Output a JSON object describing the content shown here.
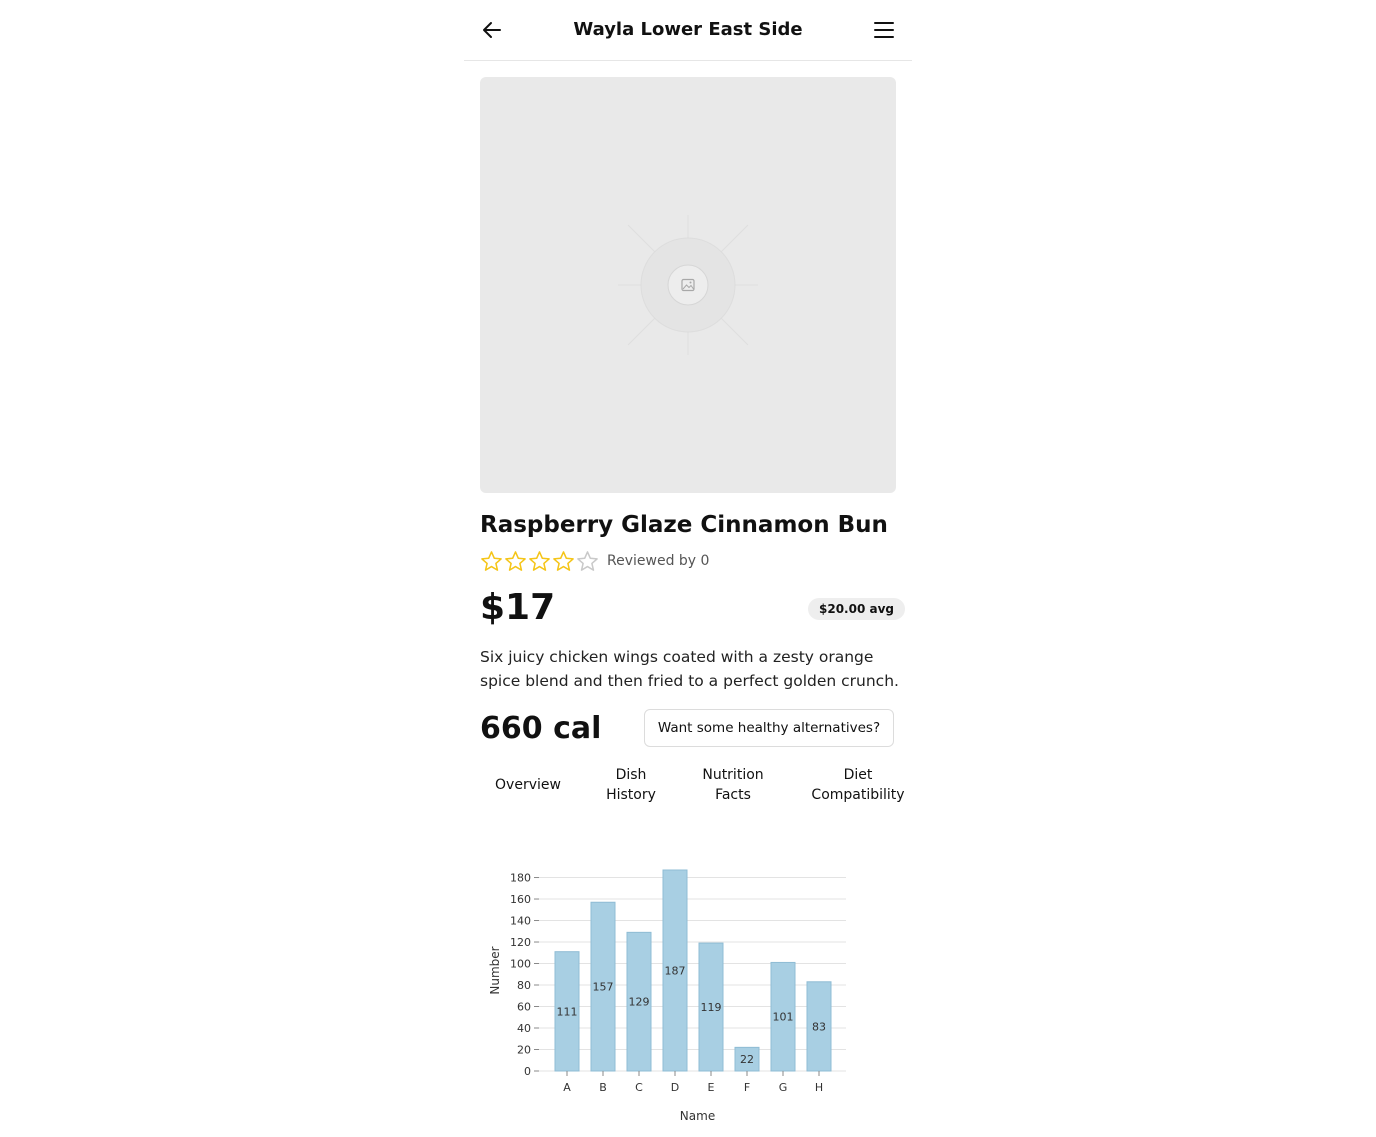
{
  "header": {
    "title": "Wayla Lower East Side",
    "back_icon": "arrow-left-icon",
    "menu_icon": "hamburger-menu-icon"
  },
  "dish": {
    "image_icon": "image-placeholder-icon",
    "name": "Raspberry Glaze Cinnamon Bun",
    "rating": 4,
    "rating_max": 5,
    "reviewed_label": "Reviewed by 0",
    "price": "$17",
    "avg_price": "$20.00 avg",
    "description": "Six juicy chicken wings coated with a zesty orange spice blend and then fried to a perfect golden crunch.",
    "calories": "660 cal",
    "alternatives_button": "Want some healthy alternatives?"
  },
  "colors": {
    "star": "#f5c518",
    "star_empty": "#c9c9c9",
    "bar": "#a8cfe3",
    "bar_stroke": "#8fbcd4"
  },
  "tabs": [
    {
      "label": "Overview"
    },
    {
      "label": "Dish History"
    },
    {
      "label": "Nutrition Facts"
    },
    {
      "label": "Diet Compatibility"
    }
  ],
  "chart_data": {
    "type": "bar",
    "categories": [
      "A",
      "B",
      "C",
      "D",
      "E",
      "F",
      "G",
      "H"
    ],
    "values": [
      111,
      157,
      129,
      187,
      119,
      22,
      101,
      83
    ],
    "xlabel": "Name",
    "ylabel": "Number",
    "ylim": [
      0,
      187
    ],
    "yticks": [
      0,
      20,
      40,
      60,
      80,
      100,
      120,
      140,
      160,
      180
    ],
    "grid": true
  }
}
